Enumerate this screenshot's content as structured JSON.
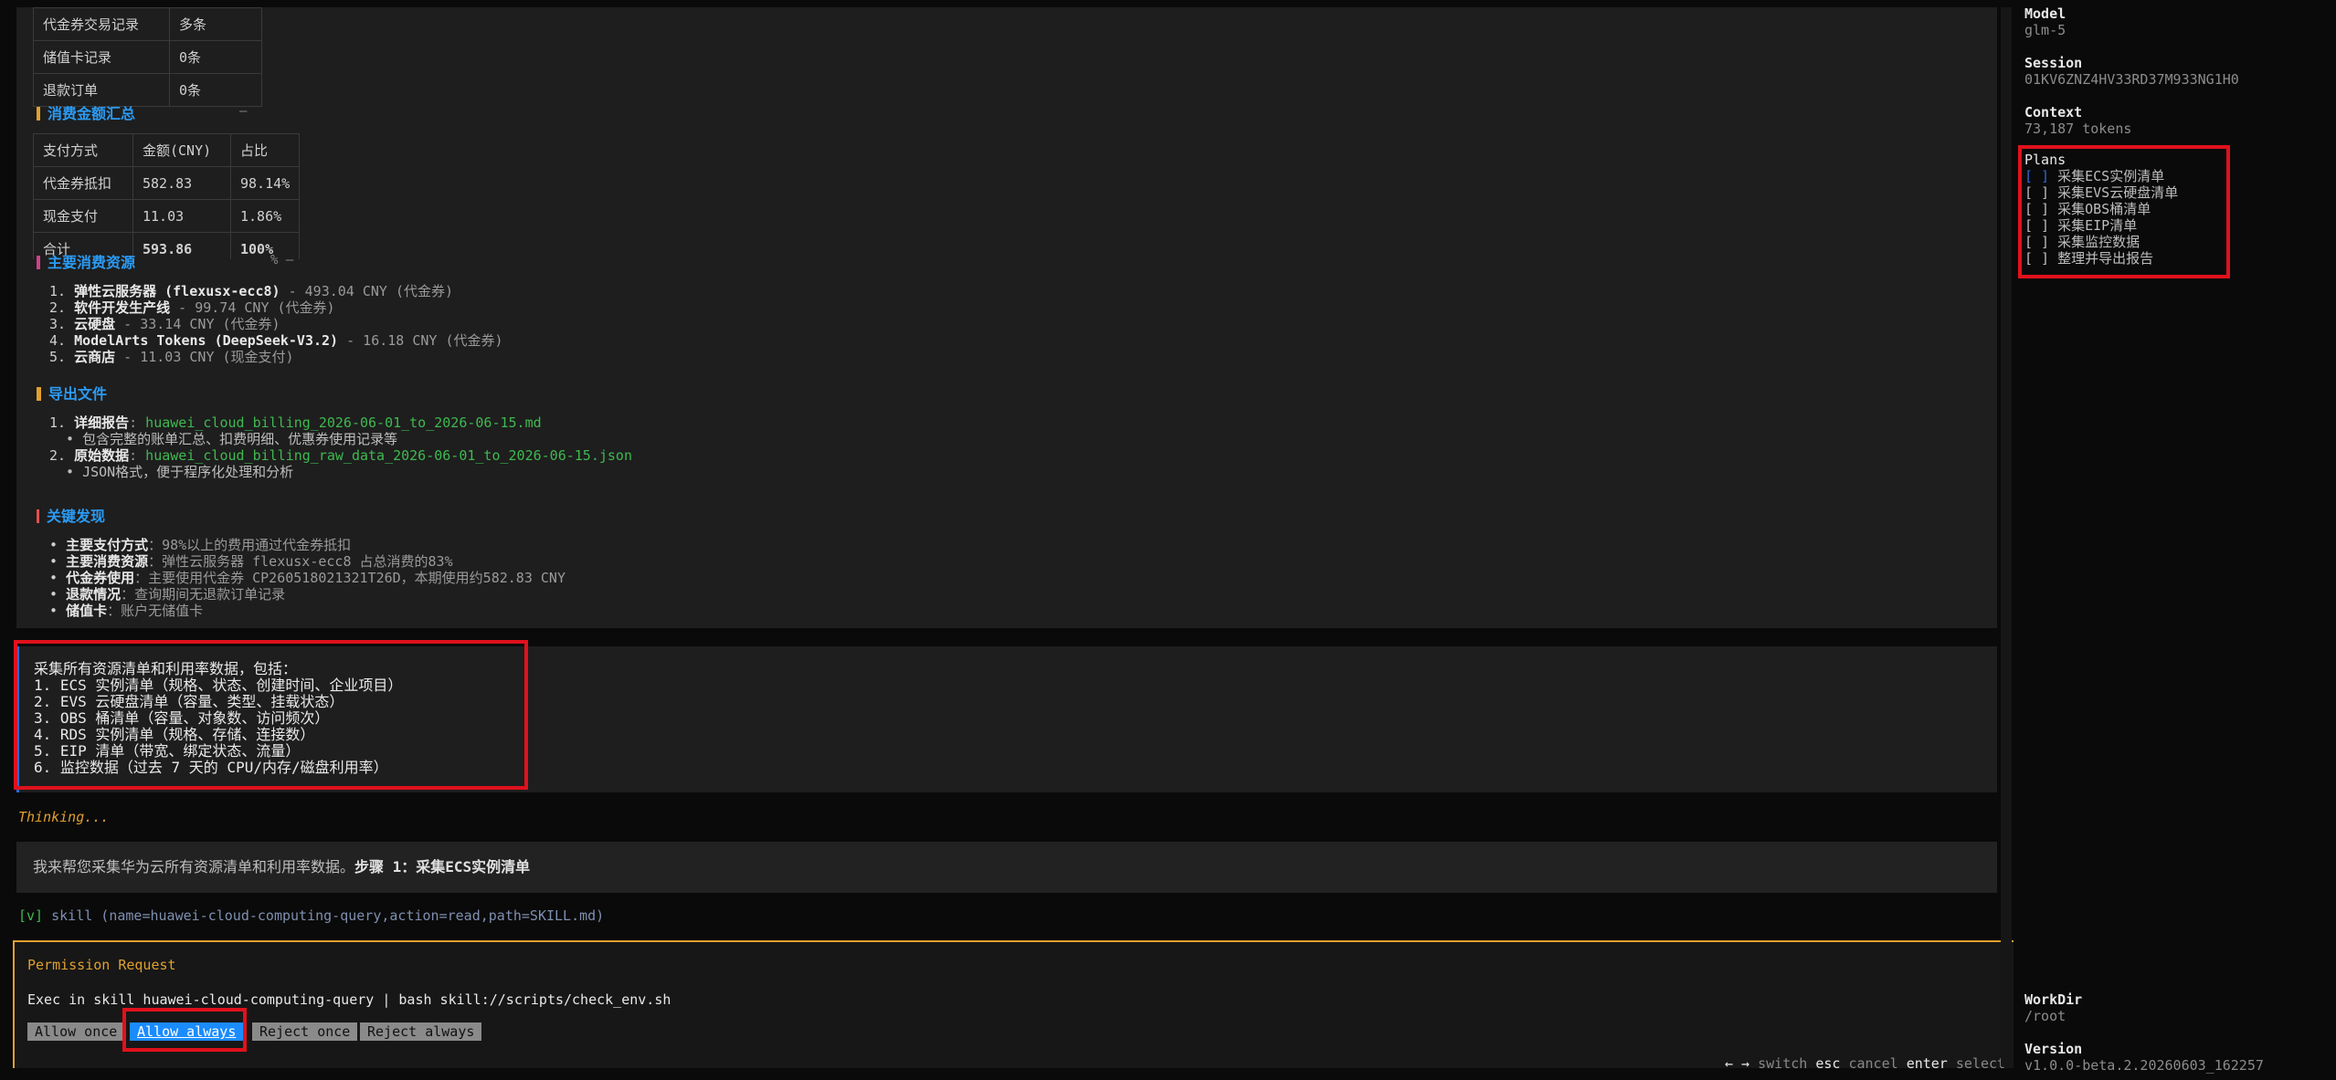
{
  "table_top": {
    "rows": [
      [
        "代金券交易记录",
        "多条"
      ],
      [
        "储值卡记录",
        "0条"
      ],
      [
        "退款订单",
        "0条"
      ]
    ]
  },
  "section_amount": {
    "title": "消费金额汇总",
    "dash": "–"
  },
  "table_amount": {
    "headers": [
      "支付方式",
      "金额(CNY)",
      "占比"
    ],
    "rows": [
      [
        "代金券抵扣",
        "582.83",
        "98.14%"
      ],
      [
        "现金支付",
        "11.03",
        "1.86%"
      ],
      [
        "合计",
        "593.86",
        "100%"
      ]
    ]
  },
  "section_resources": {
    "title": "主要消费资源",
    "dash": "% –",
    "items": [
      {
        "num": "1.",
        "name": "弹性云服务器 (flexusx-ecc8)",
        "detail": " - 493.04 CNY (代金券)"
      },
      {
        "num": "2.",
        "name": "软件开发生产线",
        "detail": " - 99.74 CNY (代金券)"
      },
      {
        "num": "3.",
        "name": "云硬盘",
        "detail": " - 33.14 CNY (代金券)"
      },
      {
        "num": "4.",
        "name": "ModelArts Tokens (DeepSeek-V3.2)",
        "detail": " - 16.18 CNY (代金券)"
      },
      {
        "num": "5.",
        "name": "云商店",
        "detail": " - 11.03 CNY (现金支付)"
      }
    ]
  },
  "section_export": {
    "title": "导出文件",
    "items": [
      {
        "num": "1.",
        "name": "详细报告",
        "sep": ": ",
        "link": "huawei_cloud_billing_2026-06-01_to_2026-06-15.md",
        "sub": "包含完整的账单汇总、扣费明细、优惠券使用记录等"
      },
      {
        "num": "2.",
        "name": "原始数据",
        "sep": ": ",
        "link": "huawei_cloud_billing_raw_data_2026-06-01_to_2026-06-15.json",
        "sub": "JSON格式，便于程序化处理和分析"
      }
    ]
  },
  "section_findings": {
    "title": "关键发现",
    "items": [
      {
        "name": "主要支付方式",
        "text": "：98%以上的费用通过代金券抵扣"
      },
      {
        "name": "主要消费资源",
        "text": "：弹性云服务器 flexusx-ecc8 占总消费的83%"
      },
      {
        "name": "代金券使用",
        "text": "：主要使用代金券 CP260518021321T26D，本期使用约582.83 CNY"
      },
      {
        "name": "退款情况",
        "text": "：查询期间无退款订单记录"
      },
      {
        "name": "储值卡",
        "text": "：账户无储值卡"
      }
    ]
  },
  "task_message": {
    "lines": [
      "采集所有资源清单和利用率数据，包括：",
      "1. ECS 实例清单（规格、状态、创建时间、企业项目）",
      "2. EVS 云硬盘清单（容量、类型、挂载状态）",
      "3. OBS 桶清单（容量、对象数、访问频次）",
      "4. RDS 实例清单（规格、存储、连接数）",
      "5. EIP 清单（带宽、绑定状态、流量）",
      "6. 监控数据（过去 7 天的 CPU/内存/磁盘利用率）"
    ]
  },
  "thinking": "Thinking...",
  "reply": {
    "text": "我来帮您采集华为云所有资源清单和利用率数据。",
    "step": "步骤 1：采集ECS实例清单"
  },
  "skill_line": {
    "check": "[v]",
    "text": "skill (name=huawei-cloud-computing-query,action=read,path=SKILL.md)"
  },
  "permission": {
    "title": "Permission Request",
    "command": "Exec in skill huawei-cloud-computing-query | bash skill://scripts/check_env.sh",
    "buttons": {
      "allow_once": "Allow once",
      "allow_always": "Allow always",
      "reject_once": "Reject once",
      "reject_always": "Reject always"
    }
  },
  "hints": {
    "arrows": "← →",
    "switch": "switch",
    "esc": "esc",
    "cancel": "cancel",
    "enter": "enter",
    "select": "select"
  },
  "sidebar": {
    "model_label": "Model",
    "model_value": "glm-5",
    "session_label": "Session",
    "session_value": "01KV6ZNZ4HV33RD37M933NG1H0",
    "context_label": "Context",
    "context_value": "73,187 tokens",
    "plans_label": "Plans",
    "plans": [
      {
        "box": "[ ]",
        "label": "采集ECS实例清单"
      },
      {
        "box": "[ ]",
        "label": "采集EVS云硬盘清单"
      },
      {
        "box": "[ ]",
        "label": "采集OBS桶清单"
      },
      {
        "box": "[ ]",
        "label": "采集EIP清单"
      },
      {
        "box": "[ ]",
        "label": "采集监控数据"
      },
      {
        "box": "[ ]",
        "label": "整理并导出报告"
      }
    ],
    "workdir_label": "WorkDir",
    "workdir_value": "/root",
    "version_label": "Version",
    "version_value": "v1.0.0-beta.2.20260603_162257"
  },
  "colors": {
    "accent_blue": "#2b9bf4",
    "warning_orange": "#e0a030",
    "link_green": "#3fb950",
    "highlight_red": "#e0111c",
    "button_active": "#1a8cff"
  }
}
